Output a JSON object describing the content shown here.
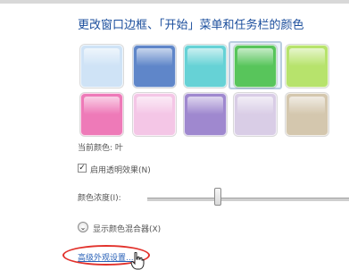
{
  "title": "更改窗口边框、「开始」菜单和任务栏的颜色",
  "swatches": [
    {
      "name": "swatch-sky",
      "color": "#cfe3f6"
    },
    {
      "name": "swatch-twilight",
      "color": "#5f86c9"
    },
    {
      "name": "swatch-sea",
      "color": "#66d2d6"
    },
    {
      "name": "swatch-leaf",
      "color": "#58c55b",
      "selected": true
    },
    {
      "name": "swatch-lime",
      "color": "#b7e36c"
    },
    {
      "name": "swatch-fuchsia",
      "color": "#ee7ab8"
    },
    {
      "name": "swatch-blush",
      "color": "#f4c6e6"
    },
    {
      "name": "swatch-violet",
      "color": "#9f88cf"
    },
    {
      "name": "swatch-lavender",
      "color": "#d9cde6"
    },
    {
      "name": "swatch-taupe",
      "color": "#d4c7ae"
    }
  ],
  "current_color_label": "当前颜色: 叶",
  "transparency": {
    "label": "启用透明效果(N)",
    "checked": true
  },
  "intensity": {
    "label": "颜色浓度(I):",
    "value_fraction": 0.35
  },
  "mixer": {
    "label": "显示颜色混合器(X)"
  },
  "advanced_link": "高级外观设置..."
}
